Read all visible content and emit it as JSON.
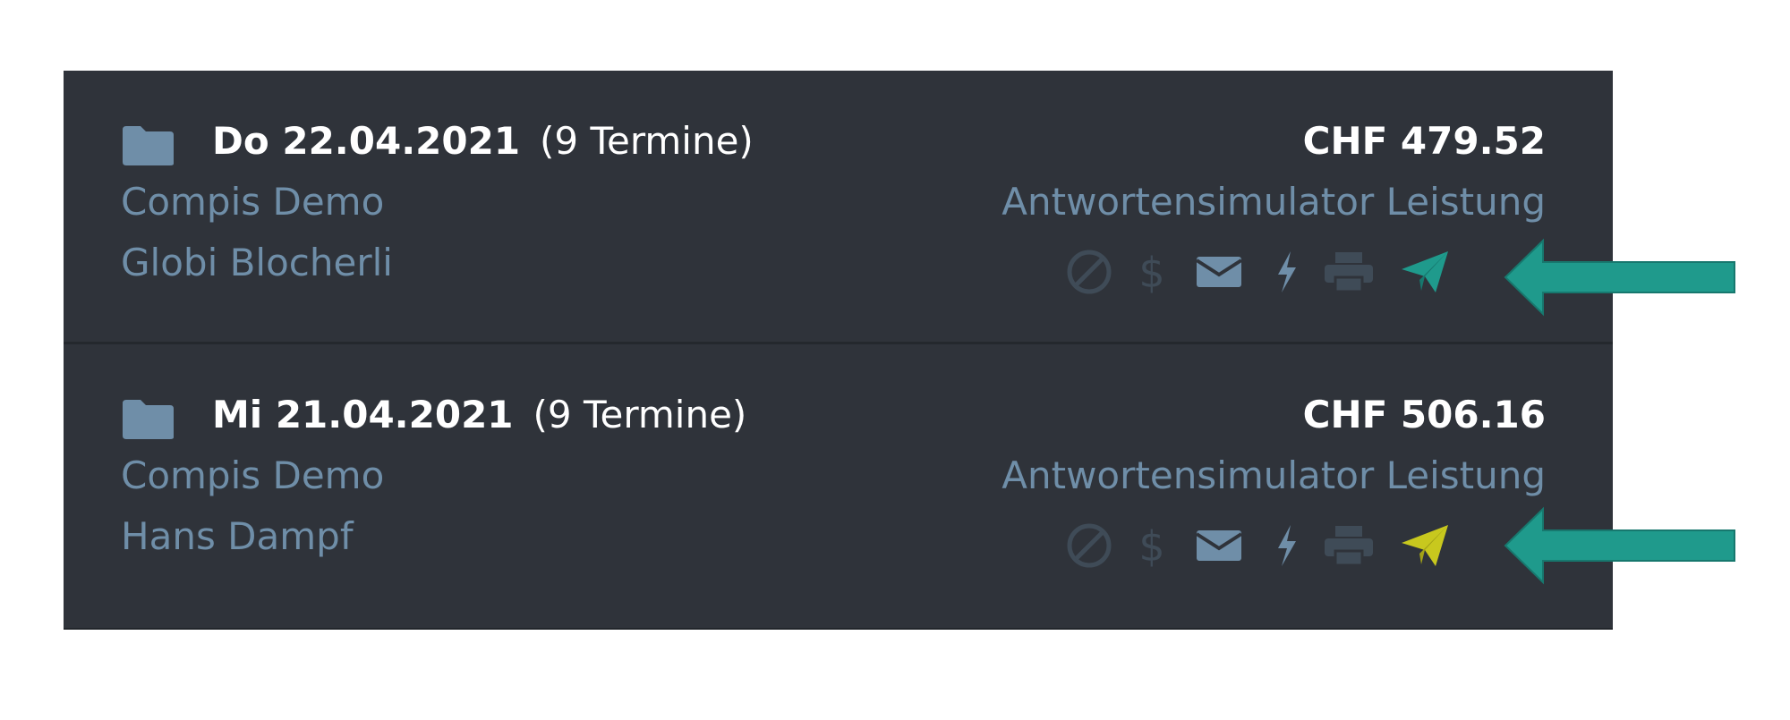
{
  "entries": [
    {
      "date": "Do 22.04.2021",
      "count": "(9 Termine)",
      "amount": "CHF 479.52",
      "client": "Compis Demo",
      "service": "Antwortensimulator Leistung",
      "patient": "Globi Blocherli",
      "send_status_color": "#1f9a8c"
    },
    {
      "date": "Mi 21.04.2021",
      "count": "(9 Termine)",
      "amount": "CHF 506.16",
      "client": "Compis Demo",
      "service": "Antwortensimulator Leistung",
      "patient": "Hans Dampf",
      "send_status_color": "#c8c81e"
    }
  ],
  "icons": [
    "ban-icon",
    "dollar-icon",
    "envelope-icon",
    "bolt-icon",
    "printer-icon",
    "paper-plane-icon"
  ],
  "colors": {
    "panel_bg": "#2f333a",
    "muted_text": "#6f8ea8",
    "annotation_arrow": "#1f9a8c"
  }
}
